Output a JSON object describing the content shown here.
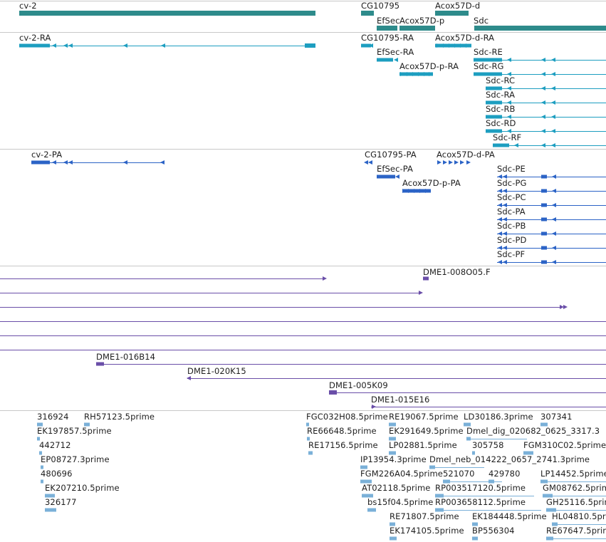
{
  "colors": {
    "gene": "#2e8b8b",
    "mrna": "#1d9ec0",
    "protein": "#2b63c6",
    "clone": "#6a4ea8",
    "est": "#7ab0d8",
    "divider": "#c8c8c8"
  },
  "tracks": {
    "genes": {
      "labels": [
        "cv-2",
        "CG10795",
        "Acox57D-d",
        "EfSec",
        "Acox57D-p",
        "Sdc"
      ]
    },
    "transcripts": {
      "labels": [
        "cv-2-RA",
        "CG10795-RA",
        "Acox57D-d-RA",
        "EfSec-RA",
        "Sdc-RE",
        "Acox57D-p-RA",
        "Sdc-RG",
        "Sdc-RC",
        "Sdc-RA",
        "Sdc-RB",
        "Sdc-RD",
        "Sdc-RF"
      ]
    },
    "proteins": {
      "labels": [
        "cv-2-PA",
        "CG10795-PA",
        "Acox57D-d-PA",
        "EfSec-PA",
        "Sdc-PE",
        "Acox57D-p-PA",
        "Sdc-PG",
        "Sdc-PC",
        "Sdc-PA",
        "Sdc-PB",
        "Sdc-PD",
        "Sdc-PF"
      ]
    },
    "clones": {
      "labels": [
        "DME1-008O05.F",
        "DME1-016B14",
        "DME1-020K15",
        "DME1-005K09",
        "DME1-015E16"
      ]
    },
    "ests": {
      "labels": [
        "316924",
        "RH57123.5prime",
        "EK197857.5prime",
        "442712",
        "EP08727.3prime",
        "480696",
        "EK207210.5prime",
        "326177",
        "FGC032H08.5prime",
        "RE19067.5prime",
        "LD30186.3prime",
        "307341",
        "RE66648.5prime",
        "EK291649.5prime",
        "Dmel_dig_020682_0625_3317.3",
        "RE17156.5prime",
        "LP02881.5prime",
        "305758",
        "FGM310C02.5prime",
        "IP13954.3prime",
        "Dmel_neb_014222_0657_2741.3prime",
        "FGM226A04.5prime",
        "521070",
        "429780",
        "LP14452.5prime",
        "AT02118.5prime",
        "RP003517120.5prime",
        "GM08762.5prime",
        "bs15f04.5prime",
        "RP003658112.5prime",
        "GH25116.5prime",
        "RE71807.5prime",
        "EK184448.5prime",
        "HL04810.5prime",
        "EK174105.5prime",
        "BP556304",
        "RE67647.5prime"
      ]
    }
  }
}
